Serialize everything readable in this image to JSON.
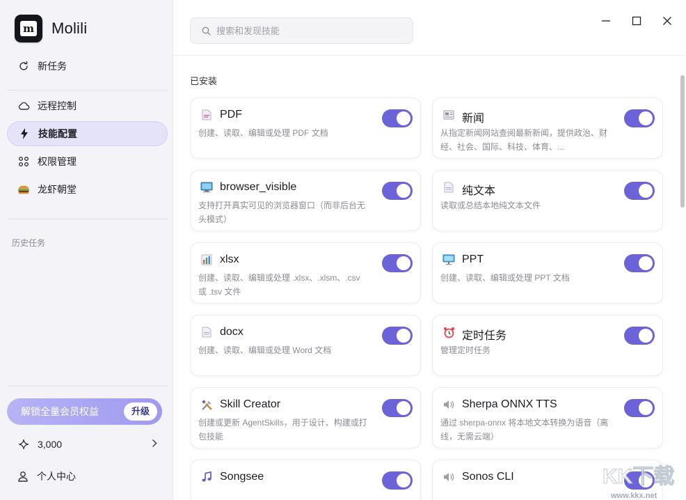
{
  "app": {
    "name": "Molili",
    "logo_letter": "m"
  },
  "sidebar": {
    "items": [
      {
        "label": "新任务",
        "icon": "refresh-plus-icon"
      },
      {
        "label": "远程控制",
        "icon": "cloud-icon"
      },
      {
        "label": "技能配置",
        "icon": "lightning-icon",
        "active": true
      },
      {
        "label": "权限管理",
        "icon": "grid-nodes-icon"
      },
      {
        "label": "龙虾朝堂",
        "icon": "burger-icon"
      }
    ],
    "history_label": "历史任务",
    "upgrade_text": "解锁全量会员权益",
    "upgrade_button": "升级",
    "credits": "3,000",
    "profile_label": "个人中心"
  },
  "search": {
    "placeholder": "搜索和发现技能",
    "value": ""
  },
  "main": {
    "installed_label": "已安装",
    "skills": [
      {
        "title": "PDF",
        "desc": "创建、读取、编辑或处理 PDF 文档",
        "icon": "pdf-file-icon",
        "enabled": true
      },
      {
        "title": "新闻",
        "desc": "从指定新闻网站查阅最新新闻，提供政治、财经、社会、国际、科技、体育、...",
        "icon": "newspaper-icon",
        "enabled": true
      },
      {
        "title": "browser_visible",
        "desc": "支持打开真实可见的浏览器窗口（而非后台无头模式）",
        "icon": "monitor-icon",
        "enabled": true
      },
      {
        "title": "纯文本",
        "desc": "读取或总结本地纯文本文件",
        "icon": "text-file-icon",
        "enabled": true
      },
      {
        "title": "xlsx",
        "desc": "创建、读取、编辑或处理 .xlsx、.xlsm、.csv 或 .tsv 文件",
        "icon": "bar-chart-icon",
        "enabled": true
      },
      {
        "title": "PPT",
        "desc": "创建、读取、编辑或处理 PPT 文档",
        "icon": "presentation-icon",
        "enabled": true
      },
      {
        "title": "docx",
        "desc": "创建、读取、编辑或处理 Word 文档",
        "icon": "doc-file-icon",
        "enabled": true
      },
      {
        "title": "定时任务",
        "desc": "管理定时任务",
        "icon": "alarm-clock-icon",
        "enabled": true
      },
      {
        "title": "Skill Creator",
        "desc": "创建或更新 AgentSkills，用于设计、构建或打包技能",
        "icon": "tools-icon",
        "enabled": true
      },
      {
        "title": "Sherpa ONNX TTS",
        "desc": "通过 sherpa-onnx 将本地文本转换为语音（离线，无需云端）",
        "icon": "speaker-icon",
        "enabled": true
      },
      {
        "title": "Songsee",
        "desc": "",
        "icon": "music-note-icon",
        "enabled": true
      },
      {
        "title": "Sonos CLI",
        "desc": "",
        "icon": "speaker-icon",
        "enabled": true
      }
    ]
  },
  "colors": {
    "accent": "#6c63d8",
    "sidebar_bg": "#f3f3f8",
    "active_item_bg": "#e4e3f9"
  },
  "watermark": {
    "text": "KK下载",
    "url": "www.kkx.net"
  }
}
